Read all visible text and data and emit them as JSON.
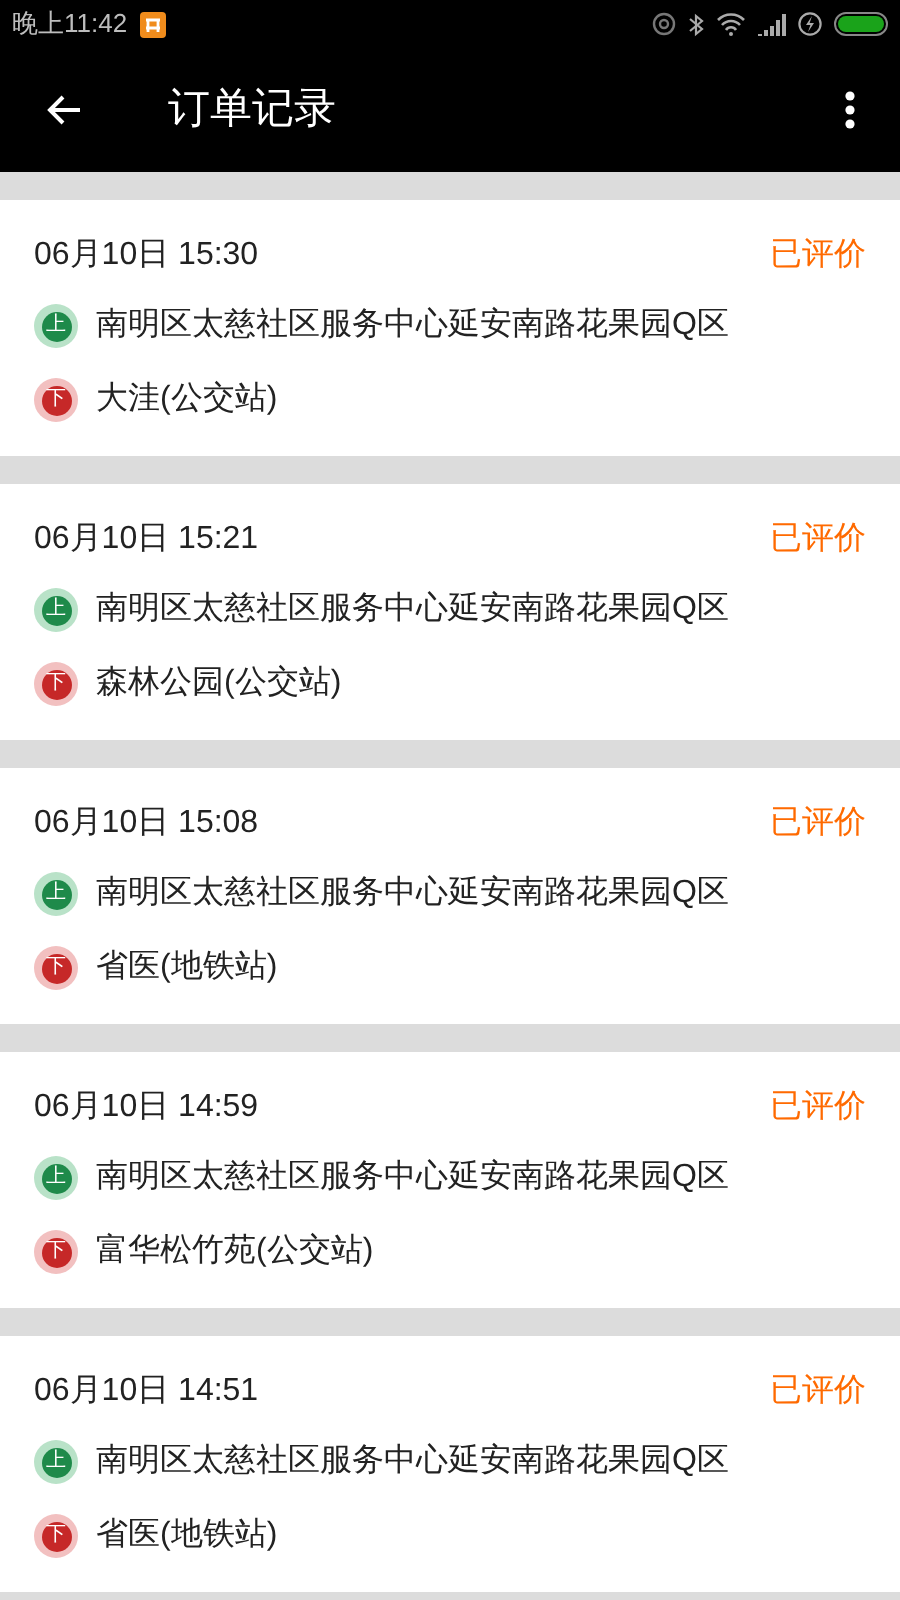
{
  "status_bar": {
    "time": "晚上11:42"
  },
  "app_bar": {
    "title": "订单记录"
  },
  "orders": [
    {
      "time": "06月10日 15:30",
      "status": "已评价",
      "pickup_mark": "上",
      "pickup": "南明区太慈社区服务中心延安南路花果园Q区",
      "dropoff_mark": "下",
      "dropoff": "大洼(公交站)"
    },
    {
      "time": "06月10日 15:21",
      "status": "已评价",
      "pickup_mark": "上",
      "pickup": "南明区太慈社区服务中心延安南路花果园Q区",
      "dropoff_mark": "下",
      "dropoff": "森林公园(公交站)"
    },
    {
      "time": "06月10日 15:08",
      "status": "已评价",
      "pickup_mark": "上",
      "pickup": "南明区太慈社区服务中心延安南路花果园Q区",
      "dropoff_mark": "下",
      "dropoff": "省医(地铁站)"
    },
    {
      "time": "06月10日 14:59",
      "status": "已评价",
      "pickup_mark": "上",
      "pickup": "南明区太慈社区服务中心延安南路花果园Q区",
      "dropoff_mark": "下",
      "dropoff": "富华松竹苑(公交站)"
    },
    {
      "time": "06月10日 14:51",
      "status": "已评价",
      "pickup_mark": "上",
      "pickup": "南明区太慈社区服务中心延安南路花果园Q区",
      "dropoff_mark": "下",
      "dropoff": "省医(地铁站)"
    }
  ]
}
